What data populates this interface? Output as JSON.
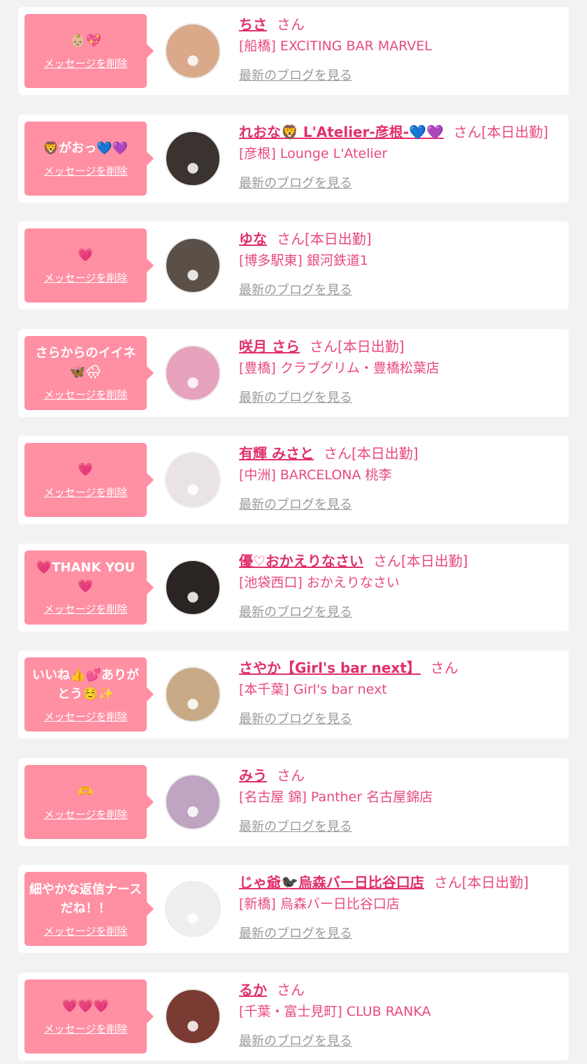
{
  "common": {
    "delete_label": "メッセージを削除",
    "blog_label": "最新のブログを見る",
    "honorific": "さん"
  },
  "colors": {
    "page_bg": "#f2f2f2",
    "card_bg": "#ffffff",
    "bubble_bg": "#ff8fa3",
    "name": "#e0306a",
    "accent_text": "#e84a7e",
    "blog_link": "#9a9a9a"
  },
  "items": [
    {
      "message": "👶🏼💖",
      "name": "ちさ",
      "status": "",
      "store": "[船橋] EXCITING BAR MARVEL",
      "avatar_icon": "puppy-filter-selfie",
      "avatar_bg": "#d9a98a"
    },
    {
      "message": "🦁がおっ💙💜",
      "name": "れおな🦁 L'Atelier-彦根-💙💜",
      "status": "[本日出勤]",
      "store": "[彦根] Lounge L'Atelier",
      "avatar_icon": "portrait-photo",
      "avatar_bg": "#3a3330"
    },
    {
      "message": "💗",
      "name": "ゆな",
      "status": "[本日出勤]",
      "store": "[博多駅東] 銀河鉄道1",
      "avatar_icon": "portrait-photo",
      "avatar_bg": "#5a5048"
    },
    {
      "message": "さらからのイイネ🦋🌧",
      "name": "咲月 さら",
      "status": "[本日出勤]",
      "store": "[豊橋] クラブグリム・豊橋松葉店",
      "avatar_icon": "portrait-photo",
      "avatar_bg": "#e7a2bd"
    },
    {
      "message": "💗",
      "name": "有輝 みさと",
      "status": "[本日出勤]",
      "store": "[中洲] BARCELONA 桃李",
      "avatar_icon": "portrait-photo",
      "avatar_bg": "#e9e3e6"
    },
    {
      "message": "💗THANK YOU💗",
      "name": "優♡おかえりなさい",
      "status": "[本日出勤]",
      "store": "[池袋西口] おかえりなさい",
      "avatar_icon": "portrait-photo",
      "avatar_bg": "#2a2422"
    },
    {
      "message": "いいね👍💕ありがとう☺️✨",
      "name": "さやか【Girl's bar next】",
      "status": "",
      "store": "[本千葉] Girl's bar next",
      "avatar_icon": "portrait-with-cat",
      "avatar_bg": "#c8ab86"
    },
    {
      "message": "🫶",
      "name": "みう",
      "status": "",
      "store": "[名古屋 錦] Panther 名古屋錦店",
      "avatar_icon": "cat-ears-selfie",
      "avatar_bg": "#bfa5c2"
    },
    {
      "message": "細やかな返信ナースだね！！",
      "name": "じゃ爺🐦‍⬛烏森バー日比谷口店",
      "status": "[本日出勤]",
      "store": "[新橋] 烏森バー日比谷口店",
      "avatar_icon": "bar-logo-portrait",
      "avatar_bg": "#f0eeee"
    },
    {
      "message": "💗💗💗",
      "name": "るか",
      "status": "",
      "store": "[千葉・富士見町] CLUB RANKA",
      "avatar_icon": "portrait-photo",
      "avatar_bg": "#7a3b33"
    }
  ]
}
